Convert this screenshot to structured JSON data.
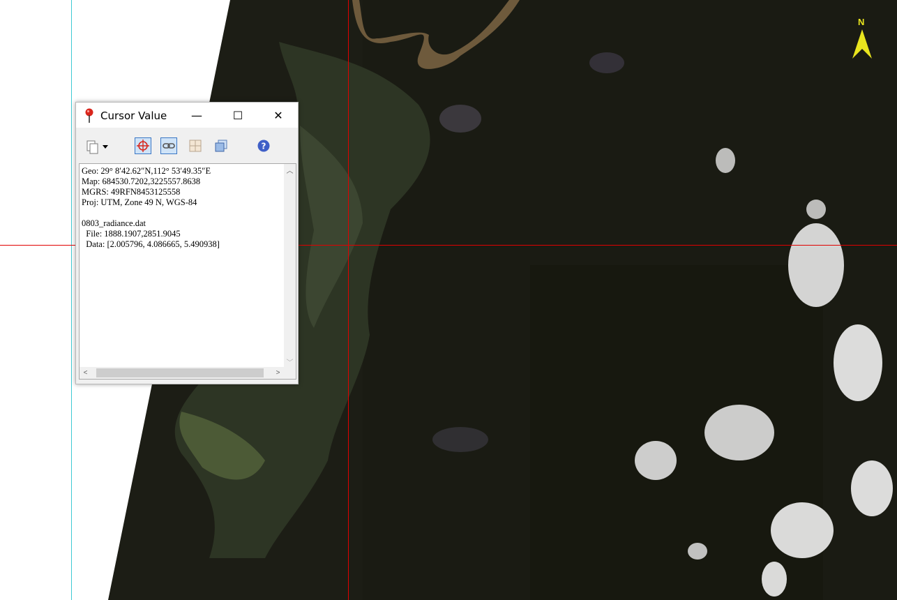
{
  "window": {
    "title": "Cursor Value",
    "minimize_glyph": "—",
    "maximize_glyph": "☐",
    "close_glyph": "✕"
  },
  "toolbar": {
    "items": [
      {
        "icon": "copy-icon",
        "pressed": false
      },
      {
        "icon": "crosshair-icon",
        "pressed": true
      },
      {
        "icon": "link-icon",
        "pressed": true
      },
      {
        "icon": "grid-icon",
        "pressed": false
      },
      {
        "icon": "stack-icon",
        "pressed": false
      },
      {
        "icon": "help-icon",
        "pressed": false
      }
    ]
  },
  "cursor_info": {
    "geo": "Geo: 29° 8′42.62″N,112° 53′49.35″E",
    "map": "Map: 684530.7202,3225557.8638",
    "mgrs": "MGRS: 49RFN8453125558",
    "proj": "Proj: UTM, Zone 49 N, WGS-84",
    "file_name": "0803_radiance.dat",
    "file_coords": "  File: 1888.1907,2851.9045",
    "data_values": "  Data: [2.005796, 4.086665, 5.490938]"
  },
  "map": {
    "north_label": "N",
    "crosshair_color": "#e00000",
    "frame_color": "#3ec9d4",
    "north_arrow_color": "#e9e51e"
  }
}
